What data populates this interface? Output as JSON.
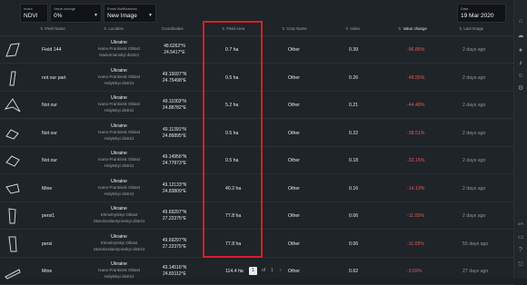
{
  "filters": {
    "index": {
      "label": "Index",
      "value": "NDVI"
    },
    "value_change": {
      "label": "Value change",
      "value": "0%"
    },
    "email_notifications": {
      "label": "Email Notifications",
      "value": "New Image"
    },
    "date": {
      "label": "Date",
      "value": "19 Mar 2020"
    }
  },
  "table": {
    "columns": [
      "Field Name",
      "Location",
      "Coordinates",
      "Field Area",
      "Crop Name",
      "Index",
      "Value change",
      "Last Image"
    ],
    "rows": [
      {
        "name": "Field 144",
        "country": "Ukraine",
        "loc1": "Ivano-Frankivsk Oblast",
        "loc2": "Nadvirnianskyi district",
        "lat": "48.6262°N",
        "lon": "24.5417°E",
        "area": "0.7 ha",
        "crop": "Other",
        "index": "0.39",
        "change": "-96.85%",
        "last": "2 days ago"
      },
      {
        "name": "not our part",
        "country": "Ukraine",
        "loc1": "Ivano-Frankivsk Oblast",
        "loc2": "Halytskyi district",
        "lat": "49.15697°N",
        "lon": "24.75498°E",
        "area": "0.5 ha",
        "crop": "Other",
        "index": "0.26",
        "change": "-48.55%",
        "last": "2 days ago"
      },
      {
        "name": "Not our",
        "country": "Ukraine",
        "loc1": "Ivano-Frankivsk Oblast",
        "loc2": "Halytskyi district",
        "lat": "49.11003°N",
        "lon": "24.88782°E",
        "area": "5.2 ha",
        "crop": "Other",
        "index": "0.21",
        "change": "-44.48%",
        "last": "2 days ago"
      },
      {
        "name": "Not our",
        "country": "Ukraine",
        "loc1": "Ivano-Frankivsk Oblast",
        "loc2": "Halytskyi district",
        "lat": "49.11391°N",
        "lon": "24.86895°E",
        "area": "0.5 ha",
        "crop": "Other",
        "index": "0.22",
        "change": "-38.51%",
        "last": "2 days ago"
      },
      {
        "name": "Not our",
        "country": "Ukraine",
        "loc1": "Ivano-Frankivsk Oblast",
        "loc2": "Halytskyi district",
        "lat": "49.14956°N",
        "lon": "24.77873°E",
        "area": "0.5 ha",
        "crop": "Other",
        "index": "0.18",
        "change": "-32.15%",
        "last": "2 days ago"
      },
      {
        "name": "Mine",
        "country": "Ukraine",
        "loc1": "Ivano-Frankivsk Oblast",
        "loc2": "Halytskyi district",
        "lat": "49.12133°N",
        "lon": "24.83809°E",
        "area": "40.2 ha",
        "crop": "Other",
        "index": "0.16",
        "change": "-14.13%",
        "last": "2 days ago"
      },
      {
        "name": "persi1",
        "country": "Ukraine",
        "loc1": "Khmelnytskyi Oblast",
        "loc2": "Starokostiantynivskyi district",
        "lat": "49.69297°N",
        "lon": "27.22375°E",
        "area": "77.8 ha",
        "crop": "Other",
        "index": "0.06",
        "change": "-11.05%",
        "last": "2 days ago"
      },
      {
        "name": "persi",
        "country": "Ukraine",
        "loc1": "Khmelnytskyi Oblast",
        "loc2": "Starokostiantynivskyi district",
        "lat": "49.69297°N",
        "lon": "27.22375°E",
        "area": "77.8 ha",
        "crop": "Other",
        "index": "0.06",
        "change": "-11.05%",
        "last": "55 days ago"
      },
      {
        "name": "Mine",
        "country": "Ukraine",
        "loc1": "Ivano-Frankivsk Oblast",
        "loc2": "Halytskyi district",
        "lat": "49.14516°N",
        "lon": "24.83112°E",
        "area": "114.4 ha",
        "crop": "Other",
        "index": "0.62",
        "change": "-3.69%",
        "last": "27 days ago"
      }
    ]
  },
  "pagination": {
    "current": "1",
    "of_label": "of",
    "total": "1"
  },
  "sidebar_icons": [
    "home-icon",
    "cloud-icon",
    "location-icon",
    "bell-icon",
    "user-icon",
    "settings-icon"
  ],
  "sidebar_label": "API",
  "colors": {
    "negative": "#e25a5a",
    "highlight": "#d41f2b",
    "background": "#1f2429"
  }
}
